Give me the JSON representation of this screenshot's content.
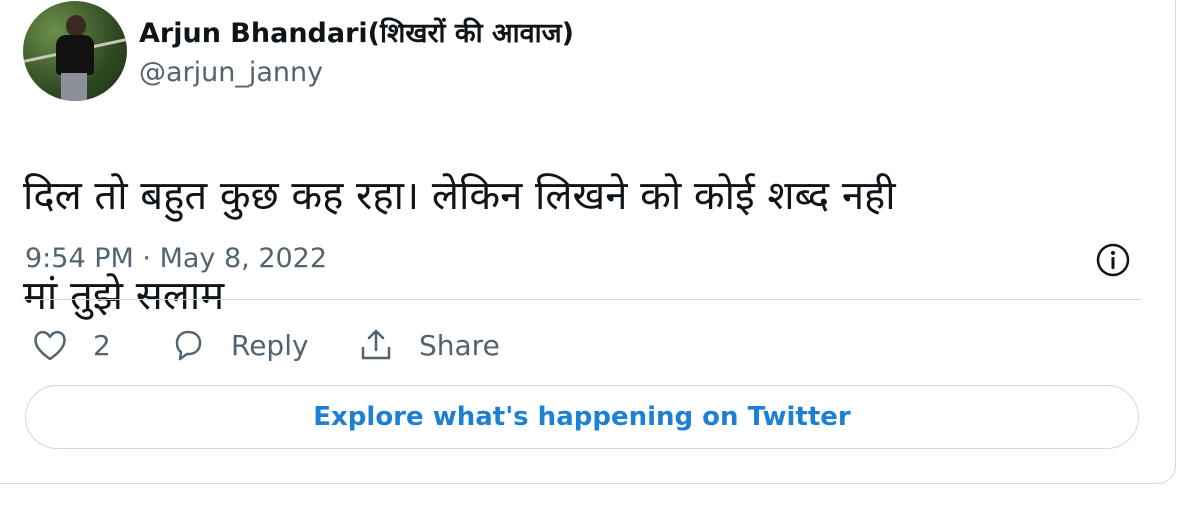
{
  "tweet": {
    "display_name": "Arjun Bhandari(शिखरों की आवाज)",
    "handle": "@arjun_janny",
    "text_line1": "दिल तो बहुत कुछ कह रहा। लेकिन लिखने को कोई शब्द नही",
    "text_line2": "मां तुझे सलाम",
    "time": "9:54 PM",
    "separator": "·",
    "date": "May 8, 2022"
  },
  "actions": {
    "like_count": "2",
    "reply_label": "Reply",
    "share_label": "Share"
  },
  "explore_label": "Explore what's happening on Twitter",
  "icons": {
    "avatar": "avatar",
    "info": "info-icon",
    "like": "heart-icon",
    "reply": "speech-bubble-icon",
    "share": "share-icon"
  },
  "colors": {
    "link": "#1d80d4",
    "muted": "#536471",
    "border": "#cfd9de"
  }
}
